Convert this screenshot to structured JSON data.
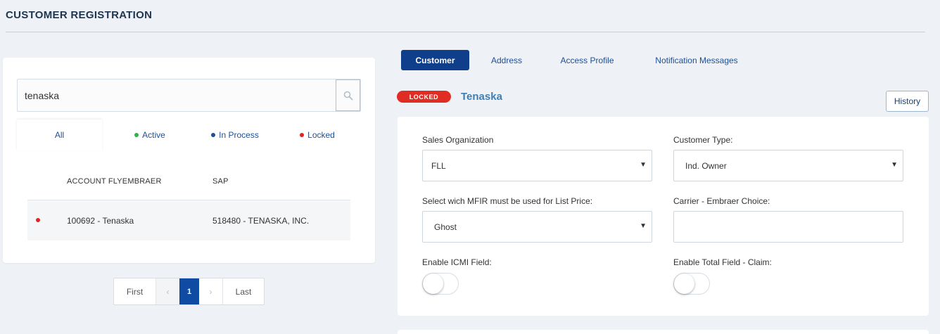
{
  "page": {
    "title": "CUSTOMER REGISTRATION"
  },
  "search": {
    "value": "tenaska"
  },
  "filters": [
    {
      "label": "All"
    },
    {
      "label": "Active",
      "dot": "#2eb24a"
    },
    {
      "label": "In Process",
      "dot": "#1d4f96"
    },
    {
      "label": "Locked",
      "dot": "#e02424"
    }
  ],
  "table": {
    "columns": [
      "ACCOUNT FLYEMBRAER",
      "SAP"
    ],
    "rows": [
      {
        "status": "locked",
        "account": "100692 - Tenaska",
        "sap": "518480 - TENASKA, INC."
      }
    ]
  },
  "pagination": {
    "first": "First",
    "prev": "‹",
    "page": "1",
    "next": "›",
    "last": "Last"
  },
  "tabs": [
    {
      "label": "Customer",
      "active": true
    },
    {
      "label": "Address"
    },
    {
      "label": "Access Profile"
    },
    {
      "label": "Notification Messages"
    }
  ],
  "customer": {
    "status": "LOCKED",
    "name": "Tenaska",
    "history_label": "History"
  },
  "form": {
    "sales_org": {
      "label": "Sales Organization",
      "value": "FLL"
    },
    "customer_type": {
      "label": "Customer Type:",
      "value": "Ind. Owner"
    },
    "mfir": {
      "label": "Select wich MFIR must be used for List Price:",
      "value": "Ghost"
    },
    "carrier": {
      "label": "Carrier - Embraer Choice:",
      "value": ""
    },
    "icmi": {
      "label": "Enable ICMI Field:",
      "enabled": false
    },
    "total_claim": {
      "label": "Enable Total Field - Claim:",
      "enabled": false
    }
  },
  "colors": {
    "primary": "#0f3f8a",
    "locked": "#e02d23",
    "link": "#1d4f96",
    "name": "#3d7fb5"
  }
}
